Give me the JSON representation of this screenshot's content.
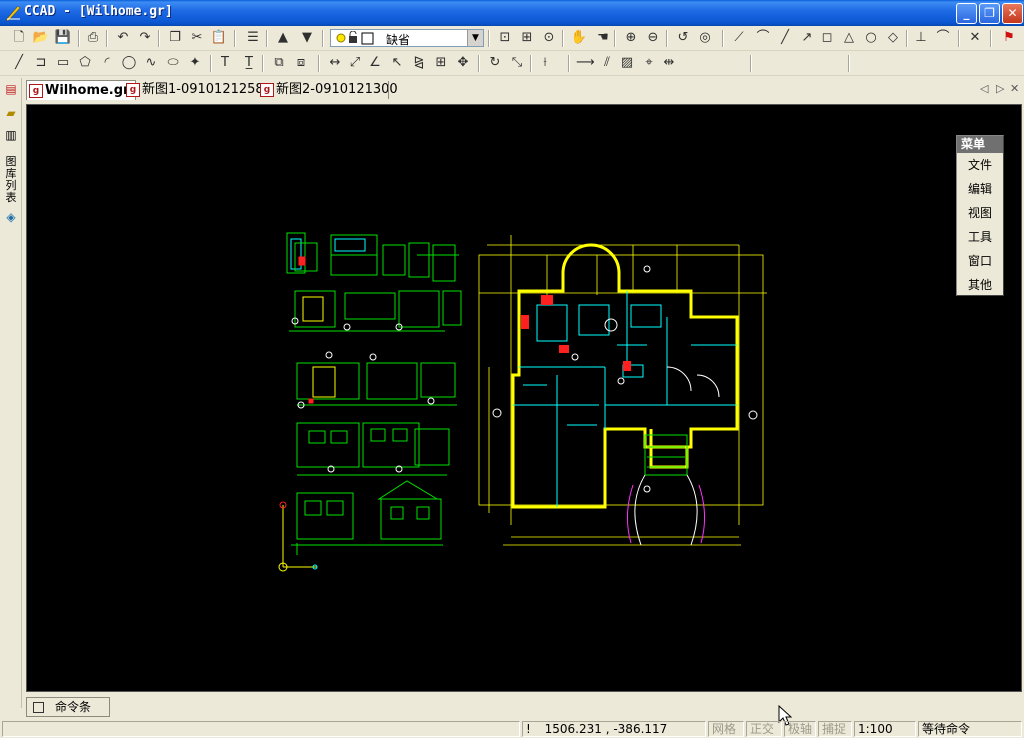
{
  "window": {
    "title": "CCAD - [Wilhome.gr]",
    "controls": {
      "minimize": "_",
      "maximize": "❐",
      "close": "✕"
    }
  },
  "toolbar": {
    "layer_value": "缺省"
  },
  "leftbar": {
    "vertical_label": "图库列表"
  },
  "tabs": [
    {
      "label": "Wilhome.gr",
      "active": true
    },
    {
      "label": "新图1-0910121258",
      "active": false
    },
    {
      "label": "新图2-0910121300",
      "active": false
    }
  ],
  "tabs_ctrl": {
    "prev": "◁",
    "next": "▷",
    "close": "✕"
  },
  "float_menu": {
    "header": "菜单",
    "items": [
      "文件",
      "编辑",
      "视图",
      "工具",
      "窗口",
      "其他"
    ]
  },
  "cmdbar": {
    "label": "命令条"
  },
  "status": {
    "coords_prefix": "!",
    "coords": "1506.231 ,  -386.117",
    "grid": "网格",
    "ortho": "正交",
    "polar": "极轴",
    "snap": "捕捉",
    "scale": "1:100",
    "message": "等待命令"
  },
  "colors": {
    "titlebar": "#0A55D0",
    "canvas": "#000000",
    "drawing_green": "#00E000",
    "drawing_yellow": "#FFFF00",
    "drawing_cyan": "#00FFFF",
    "drawing_white": "#FFFFFF"
  },
  "icons": {
    "toolbar1": [
      "new-icon",
      "open-icon",
      "save-icon",
      "print-icon",
      "undo-icon",
      "redo-icon",
      "copy-icon",
      "cut-icon",
      "paste-icon",
      "layer-icon",
      "layer-up-icon",
      "layer-down-icon",
      "zoom-window-icon",
      "zoom-extents-icon",
      "zoom-icon",
      "pan-icon",
      "pan-realtime-icon",
      "zoom-in-icon",
      "zoom-out-icon",
      "zoom-prev-icon",
      "zoom-all-icon",
      "line-snap-icon",
      "arc-snap-icon",
      "polyline-icon",
      "dimension-icon",
      "endpoint-icon",
      "midpoint-icon",
      "center-icon",
      "quadrant-icon",
      "perpendicular-icon",
      "tangent-icon",
      "nearest-icon",
      "flag-icon"
    ],
    "toolbar2": [
      "line-icon",
      "polyline-draw-icon",
      "rectangle-icon",
      "polygon-icon",
      "arc-icon",
      "circle-icon",
      "spline-icon",
      "ellipse-icon",
      "point-icon",
      "text-icon",
      "mtext-icon",
      "block-icon",
      "insert-icon",
      "dim-linear-icon",
      "dim-aligned-icon",
      "dim-angular-icon",
      "leader-icon",
      "mirror-icon",
      "array-icon",
      "move-icon",
      "rotate-icon",
      "scale-icon",
      "trim-icon",
      "extend-icon",
      "offset-icon",
      "hatch-icon",
      "xyz-icon",
      "measure-icon"
    ]
  }
}
